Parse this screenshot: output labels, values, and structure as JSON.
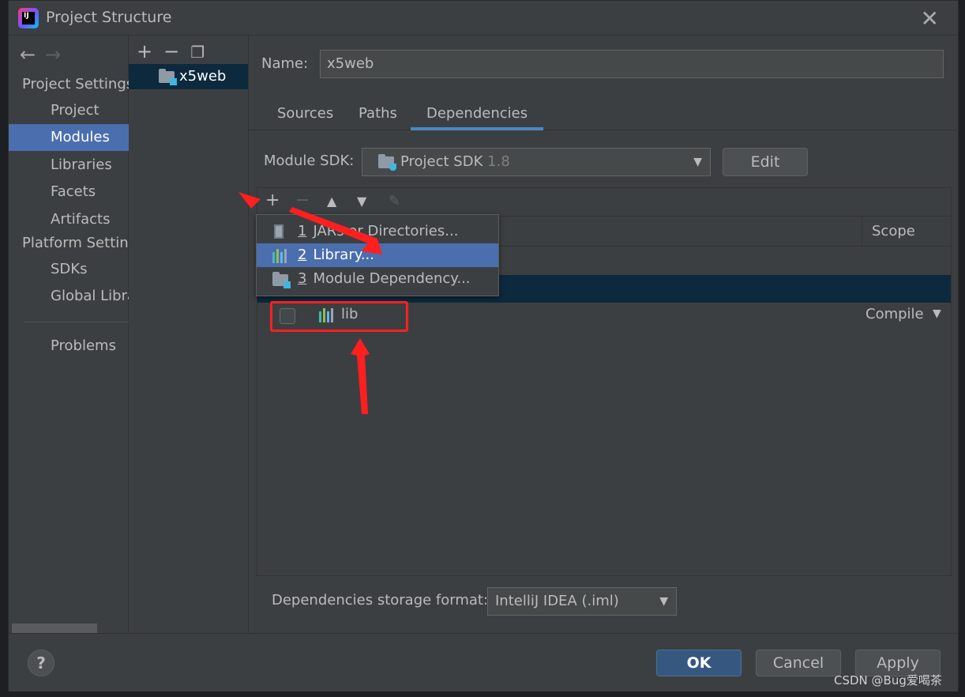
{
  "window": {
    "title": "Project Structure"
  },
  "nav": {
    "project_settings": "Project Settings",
    "items_project": [
      {
        "label": "Project"
      },
      {
        "label": "Modules"
      },
      {
        "label": "Libraries"
      },
      {
        "label": "Facets"
      },
      {
        "label": "Artifacts"
      }
    ],
    "platform_settings": "Platform Settings",
    "items_platform": [
      {
        "label": "SDKs"
      },
      {
        "label": "Global Libraries"
      }
    ],
    "problems": "Problems"
  },
  "modules": {
    "items": [
      {
        "label": "x5web"
      }
    ]
  },
  "main": {
    "name_label": "Name:",
    "name_value": "x5web",
    "tabs": [
      {
        "label": "Sources"
      },
      {
        "label": "Paths"
      },
      {
        "label": "Dependencies"
      }
    ],
    "sdk_label": "Module SDK:",
    "sdk_value": "Project SDK",
    "sdk_version": "1.8",
    "edit_label": "Edit",
    "scope_header": "Scope",
    "dependency": {
      "name": "lib",
      "scope": "Compile",
      "checked": false
    },
    "storage_label": "Dependencies storage format:",
    "storage_value": "IntelliJ IDEA (.iml)"
  },
  "popup": {
    "items": [
      {
        "num": "1",
        "label": "JARs or Directories..."
      },
      {
        "num": "2",
        "label": "Library..."
      },
      {
        "num": "3",
        "label": "Module Dependency..."
      }
    ]
  },
  "buttons": {
    "help": "?",
    "ok": "OK",
    "cancel": "Cancel",
    "apply": "Apply"
  },
  "watermark": "CSDN @Bug爱喝茶",
  "colors": {
    "accent": "#4b6eaf",
    "selection_dark": "#0d293e",
    "annotation": "#ff1f1f",
    "ok_button": "#365880"
  }
}
